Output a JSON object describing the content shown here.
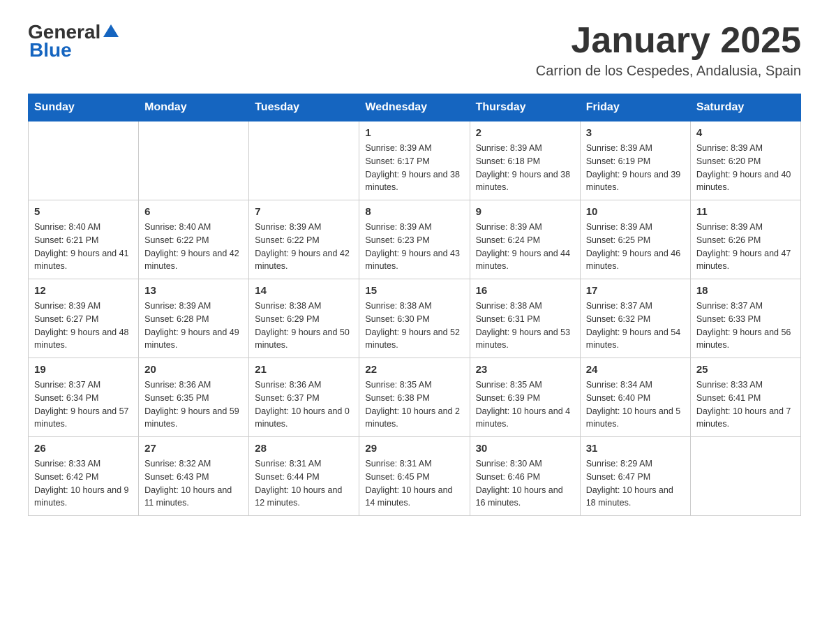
{
  "header": {
    "logo_general": "General",
    "logo_blue": "Blue",
    "month": "January 2025",
    "location": "Carrion de los Cespedes, Andalusia, Spain"
  },
  "days_of_week": [
    "Sunday",
    "Monday",
    "Tuesday",
    "Wednesday",
    "Thursday",
    "Friday",
    "Saturday"
  ],
  "weeks": [
    [
      {
        "day": "",
        "sunrise": "",
        "sunset": "",
        "daylight": ""
      },
      {
        "day": "",
        "sunrise": "",
        "sunset": "",
        "daylight": ""
      },
      {
        "day": "",
        "sunrise": "",
        "sunset": "",
        "daylight": ""
      },
      {
        "day": "1",
        "sunrise": "Sunrise: 8:39 AM",
        "sunset": "Sunset: 6:17 PM",
        "daylight": "Daylight: 9 hours and 38 minutes."
      },
      {
        "day": "2",
        "sunrise": "Sunrise: 8:39 AM",
        "sunset": "Sunset: 6:18 PM",
        "daylight": "Daylight: 9 hours and 38 minutes."
      },
      {
        "day": "3",
        "sunrise": "Sunrise: 8:39 AM",
        "sunset": "Sunset: 6:19 PM",
        "daylight": "Daylight: 9 hours and 39 minutes."
      },
      {
        "day": "4",
        "sunrise": "Sunrise: 8:39 AM",
        "sunset": "Sunset: 6:20 PM",
        "daylight": "Daylight: 9 hours and 40 minutes."
      }
    ],
    [
      {
        "day": "5",
        "sunrise": "Sunrise: 8:40 AM",
        "sunset": "Sunset: 6:21 PM",
        "daylight": "Daylight: 9 hours and 41 minutes."
      },
      {
        "day": "6",
        "sunrise": "Sunrise: 8:40 AM",
        "sunset": "Sunset: 6:22 PM",
        "daylight": "Daylight: 9 hours and 42 minutes."
      },
      {
        "day": "7",
        "sunrise": "Sunrise: 8:39 AM",
        "sunset": "Sunset: 6:22 PM",
        "daylight": "Daylight: 9 hours and 42 minutes."
      },
      {
        "day": "8",
        "sunrise": "Sunrise: 8:39 AM",
        "sunset": "Sunset: 6:23 PM",
        "daylight": "Daylight: 9 hours and 43 minutes."
      },
      {
        "day": "9",
        "sunrise": "Sunrise: 8:39 AM",
        "sunset": "Sunset: 6:24 PM",
        "daylight": "Daylight: 9 hours and 44 minutes."
      },
      {
        "day": "10",
        "sunrise": "Sunrise: 8:39 AM",
        "sunset": "Sunset: 6:25 PM",
        "daylight": "Daylight: 9 hours and 46 minutes."
      },
      {
        "day": "11",
        "sunrise": "Sunrise: 8:39 AM",
        "sunset": "Sunset: 6:26 PM",
        "daylight": "Daylight: 9 hours and 47 minutes."
      }
    ],
    [
      {
        "day": "12",
        "sunrise": "Sunrise: 8:39 AM",
        "sunset": "Sunset: 6:27 PM",
        "daylight": "Daylight: 9 hours and 48 minutes."
      },
      {
        "day": "13",
        "sunrise": "Sunrise: 8:39 AM",
        "sunset": "Sunset: 6:28 PM",
        "daylight": "Daylight: 9 hours and 49 minutes."
      },
      {
        "day": "14",
        "sunrise": "Sunrise: 8:38 AM",
        "sunset": "Sunset: 6:29 PM",
        "daylight": "Daylight: 9 hours and 50 minutes."
      },
      {
        "day": "15",
        "sunrise": "Sunrise: 8:38 AM",
        "sunset": "Sunset: 6:30 PM",
        "daylight": "Daylight: 9 hours and 52 minutes."
      },
      {
        "day": "16",
        "sunrise": "Sunrise: 8:38 AM",
        "sunset": "Sunset: 6:31 PM",
        "daylight": "Daylight: 9 hours and 53 minutes."
      },
      {
        "day": "17",
        "sunrise": "Sunrise: 8:37 AM",
        "sunset": "Sunset: 6:32 PM",
        "daylight": "Daylight: 9 hours and 54 minutes."
      },
      {
        "day": "18",
        "sunrise": "Sunrise: 8:37 AM",
        "sunset": "Sunset: 6:33 PM",
        "daylight": "Daylight: 9 hours and 56 minutes."
      }
    ],
    [
      {
        "day": "19",
        "sunrise": "Sunrise: 8:37 AM",
        "sunset": "Sunset: 6:34 PM",
        "daylight": "Daylight: 9 hours and 57 minutes."
      },
      {
        "day": "20",
        "sunrise": "Sunrise: 8:36 AM",
        "sunset": "Sunset: 6:35 PM",
        "daylight": "Daylight: 9 hours and 59 minutes."
      },
      {
        "day": "21",
        "sunrise": "Sunrise: 8:36 AM",
        "sunset": "Sunset: 6:37 PM",
        "daylight": "Daylight: 10 hours and 0 minutes."
      },
      {
        "day": "22",
        "sunrise": "Sunrise: 8:35 AM",
        "sunset": "Sunset: 6:38 PM",
        "daylight": "Daylight: 10 hours and 2 minutes."
      },
      {
        "day": "23",
        "sunrise": "Sunrise: 8:35 AM",
        "sunset": "Sunset: 6:39 PM",
        "daylight": "Daylight: 10 hours and 4 minutes."
      },
      {
        "day": "24",
        "sunrise": "Sunrise: 8:34 AM",
        "sunset": "Sunset: 6:40 PM",
        "daylight": "Daylight: 10 hours and 5 minutes."
      },
      {
        "day": "25",
        "sunrise": "Sunrise: 8:33 AM",
        "sunset": "Sunset: 6:41 PM",
        "daylight": "Daylight: 10 hours and 7 minutes."
      }
    ],
    [
      {
        "day": "26",
        "sunrise": "Sunrise: 8:33 AM",
        "sunset": "Sunset: 6:42 PM",
        "daylight": "Daylight: 10 hours and 9 minutes."
      },
      {
        "day": "27",
        "sunrise": "Sunrise: 8:32 AM",
        "sunset": "Sunset: 6:43 PM",
        "daylight": "Daylight: 10 hours and 11 minutes."
      },
      {
        "day": "28",
        "sunrise": "Sunrise: 8:31 AM",
        "sunset": "Sunset: 6:44 PM",
        "daylight": "Daylight: 10 hours and 12 minutes."
      },
      {
        "day": "29",
        "sunrise": "Sunrise: 8:31 AM",
        "sunset": "Sunset: 6:45 PM",
        "daylight": "Daylight: 10 hours and 14 minutes."
      },
      {
        "day": "30",
        "sunrise": "Sunrise: 8:30 AM",
        "sunset": "Sunset: 6:46 PM",
        "daylight": "Daylight: 10 hours and 16 minutes."
      },
      {
        "day": "31",
        "sunrise": "Sunrise: 8:29 AM",
        "sunset": "Sunset: 6:47 PM",
        "daylight": "Daylight: 10 hours and 18 minutes."
      },
      {
        "day": "",
        "sunrise": "",
        "sunset": "",
        "daylight": ""
      }
    ]
  ]
}
